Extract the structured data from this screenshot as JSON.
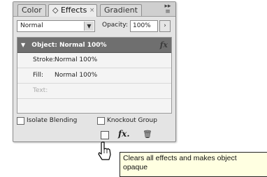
{
  "tabs": [
    {
      "label": "Color"
    },
    {
      "label": "◇ Effects"
    },
    {
      "label": "Gradient"
    }
  ],
  "tab_close_glyph": "×",
  "panel_menu_glyph": "▸▸\n≡",
  "blend": {
    "mode": "Normal"
  },
  "opacity": {
    "label": "Opacity:",
    "value": "100%"
  },
  "object_row": {
    "label": "Object: Normal 100%",
    "fx": "fx"
  },
  "attributes": [
    {
      "label": "Stroke:",
      "value": "Normal 100%"
    },
    {
      "label": "Fill:",
      "value": "Normal 100%"
    },
    {
      "label": "Text:",
      "value": ""
    }
  ],
  "options": {
    "isolate_label": "Isolate Blending",
    "knockout_label": "Knockout Group"
  },
  "bottom_icons": {
    "fx_label": "fx.",
    "clear_icon": "clear-effects-icon",
    "trash_icon": "trash-icon"
  },
  "tooltip": {
    "line1": "Clears all effects and makes object",
    "line2": "opaque"
  }
}
